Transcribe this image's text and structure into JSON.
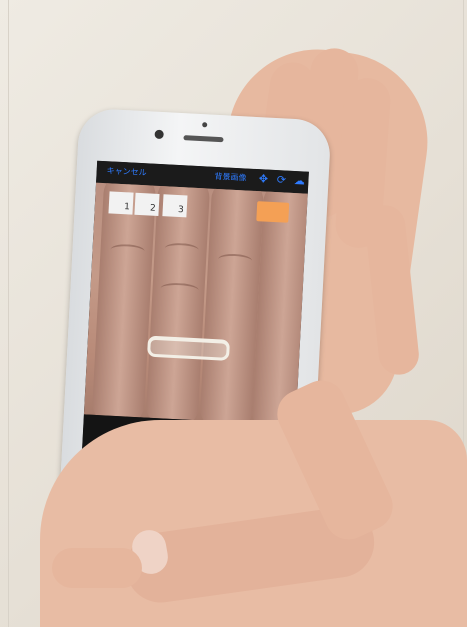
{
  "nav": {
    "cancel_label": "キャンセル",
    "background_label": "背景画像",
    "icons": [
      "move-icon",
      "rotate-icon",
      "cloud-icon"
    ]
  },
  "overlay": {
    "numbers": [
      "1",
      "2",
      "3"
    ]
  },
  "controls": {
    "icons": [
      "camera-icon",
      "zoom-in-icon",
      "zoom-out-icon",
      "zoom-in-icon",
      "zoom-out-icon",
      "camera-icon"
    ]
  },
  "colors": {
    "accent": "#2e7bff",
    "control_icon": "#2e56ff",
    "overlay_button": "#f4a055"
  }
}
